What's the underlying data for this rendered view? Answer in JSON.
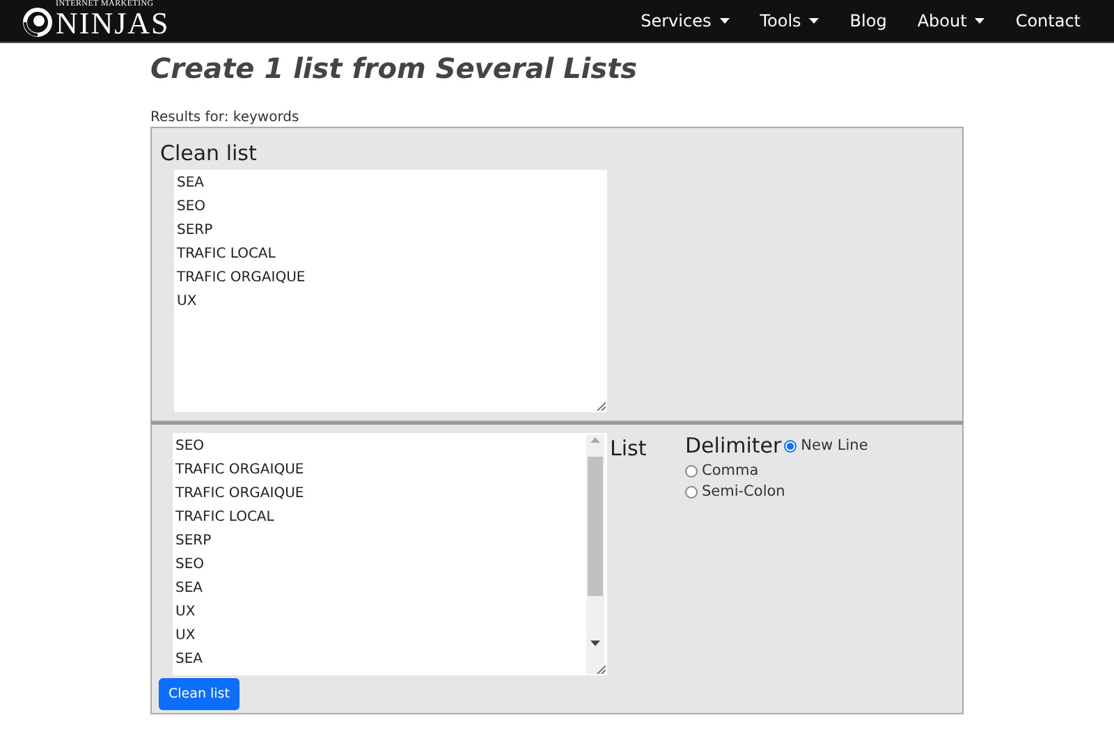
{
  "nav": {
    "logo_tagline": "INTERNET MARKETING",
    "logo_name": "NINJAS",
    "items": [
      {
        "label": "Services",
        "dropdown": true
      },
      {
        "label": "Tools",
        "dropdown": true
      },
      {
        "label": "Blog",
        "dropdown": false
      },
      {
        "label": "About",
        "dropdown": true
      },
      {
        "label": "Contact",
        "dropdown": false
      }
    ]
  },
  "title": "Create 1 list from Several Lists",
  "results_label": "Results for: keywords",
  "clean_panel": {
    "label": "Clean list",
    "lines": [
      "SEA",
      "SEO",
      "SERP",
      "TRAFIC LOCAL",
      "TRAFIC ORGAIQUE",
      "UX"
    ]
  },
  "input_panel": {
    "lines": [
      "SEO",
      "TRAFIC ORGAIQUE",
      "TRAFIC ORGAIQUE",
      "TRAFIC LOCAL",
      "SERP",
      "SEO",
      "SEA",
      "UX",
      "UX",
      "SEA"
    ],
    "list_label": "List",
    "delimiter_label": "Delimiter",
    "delimiters": [
      {
        "label": "New Line",
        "selected": true
      },
      {
        "label": "Comma",
        "selected": false
      },
      {
        "label": "Semi-Colon",
        "selected": false
      }
    ],
    "button": "Clean list"
  }
}
